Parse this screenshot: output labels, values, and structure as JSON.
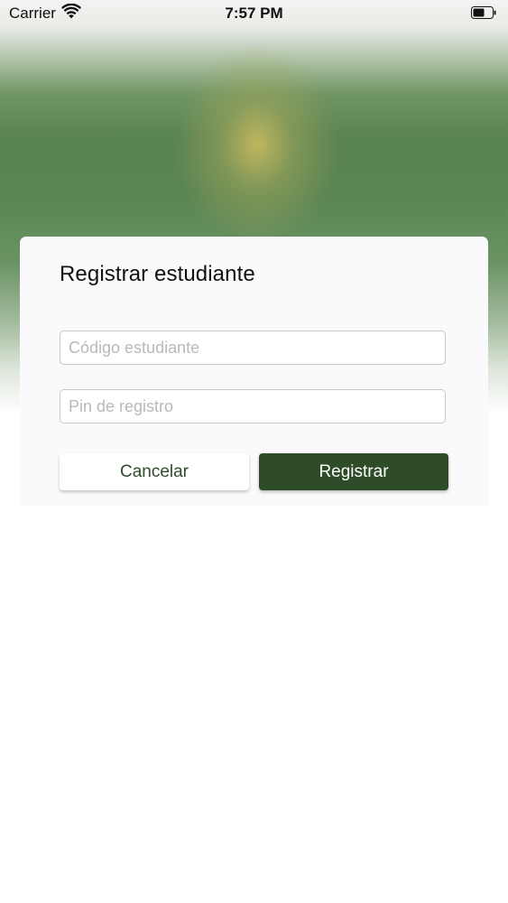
{
  "status_bar": {
    "carrier": "Carrier",
    "time": "7:57 PM",
    "wifi_icon": "wifi-icon",
    "battery_icon": "battery-icon"
  },
  "dialog": {
    "title": "Registrar estudiante",
    "student_code_placeholder": "Código estudiante",
    "student_code_value": "",
    "pin_placeholder": "Pin de registro",
    "pin_value": "",
    "cancel_label": "Cancelar",
    "register_label": "Registrar"
  },
  "colors": {
    "primary_button": "#2e4c27",
    "cancel_text": "#2f4a2c",
    "background_green": "#5a8452"
  }
}
